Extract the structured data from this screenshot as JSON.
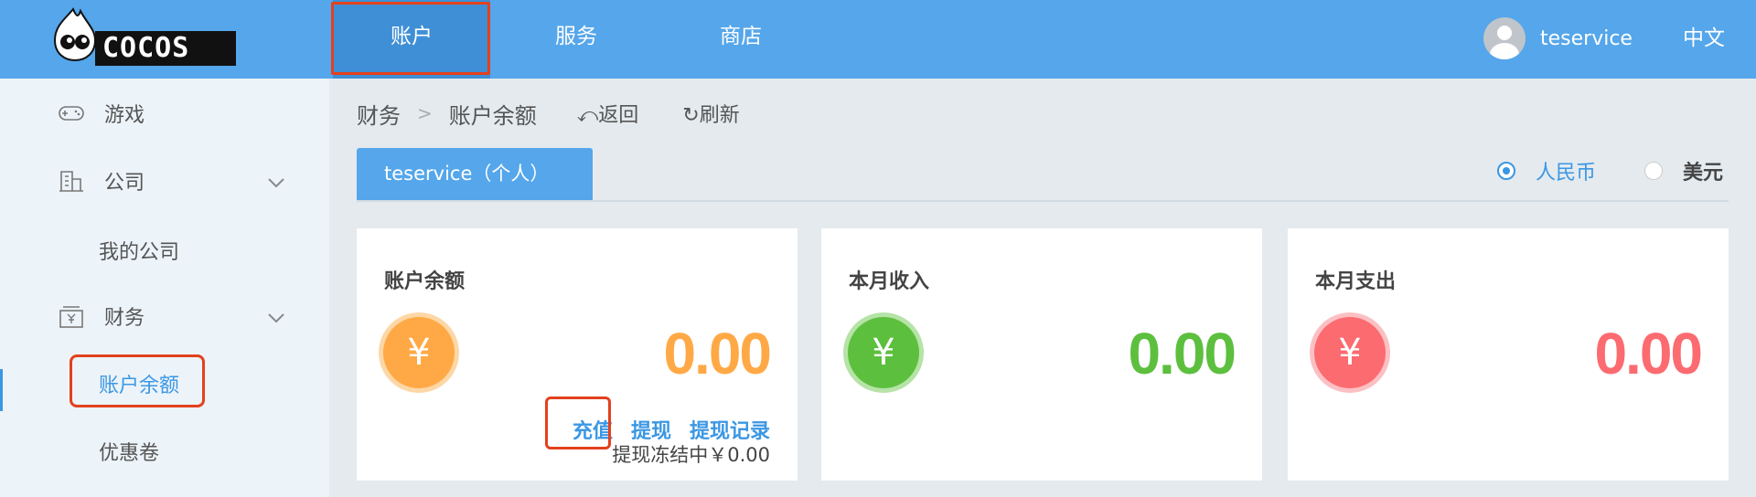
{
  "brand": {
    "logo_text": "COCOS"
  },
  "topnav": {
    "items": [
      {
        "label": "账户"
      },
      {
        "label": "服务"
      },
      {
        "label": "商店"
      }
    ],
    "username": "teservice",
    "language": "中文"
  },
  "sidebar": {
    "items": [
      {
        "label": "游戏",
        "icon": "gamepad-icon"
      },
      {
        "label": "公司",
        "icon": "building-icon"
      },
      {
        "label": "我的公司"
      },
      {
        "label": "财务",
        "icon": "finance-icon"
      },
      {
        "label": "账户余额",
        "active": true
      },
      {
        "label": "优惠卷"
      }
    ]
  },
  "breadcrumb": {
    "parent": "财务",
    "separator": ">",
    "current": "账户余额",
    "back": "⤺返回",
    "refresh": "↻刷新"
  },
  "tab": {
    "label": "teservice（个人）"
  },
  "currency": {
    "options": [
      {
        "label": "人民币",
        "selected": true
      },
      {
        "label": "美元",
        "selected": false
      }
    ]
  },
  "cards": [
    {
      "title": "账户余额",
      "symbol": "¥",
      "amount": "0.00",
      "color": "#ffa946"
    },
    {
      "title": "本月收入",
      "symbol": "¥",
      "amount": "0.00",
      "color": "#5dbf3e"
    },
    {
      "title": "本月支出",
      "symbol": "¥",
      "amount": "0.00",
      "color": "#fb6b70"
    }
  ],
  "balance_actions": {
    "recharge": "充值",
    "withdraw": "提现",
    "withdraw_record": "提现记录",
    "frozen": "提现冻结中￥0.00"
  },
  "colors": {
    "topbar": "#55a6ea",
    "accent": "#3b97e3",
    "highlight_box": "#e3411d"
  }
}
